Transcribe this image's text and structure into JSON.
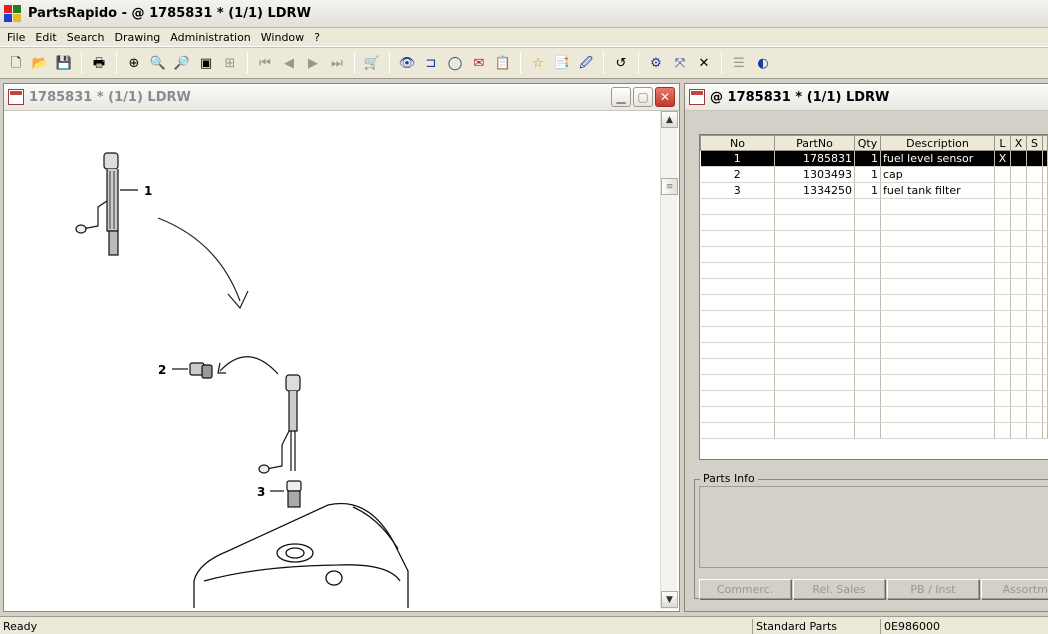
{
  "window": {
    "title": "PartsRapido - @ 1785831 * (1/1) LDRW"
  },
  "menu": [
    "File",
    "Edit",
    "Search",
    "Drawing",
    "Administration",
    "Window",
    "?"
  ],
  "toolbar": {
    "g1": [
      "🗋",
      "📂",
      "💾"
    ],
    "g2": [
      "🖶"
    ],
    "g3": [
      "⊕",
      "🔍",
      "🔎",
      "▣",
      "⊞"
    ],
    "g4": [
      "⏮",
      "◀",
      "▶",
      "⏭"
    ],
    "g5": [
      "🛒"
    ],
    "g6": [
      "👁",
      "⊐",
      "◯",
      "✉",
      "📋"
    ],
    "g7": [
      "☆",
      "📑",
      "🖉"
    ],
    "g8": [
      "↺"
    ],
    "g9": [
      "⚙",
      "⤧",
      "✕"
    ],
    "g10": [
      "☰",
      "◐"
    ]
  },
  "drawing_window": {
    "title": "1785831 * (1/1) LDRW",
    "callouts": [
      "1",
      "2",
      "3"
    ]
  },
  "parts_window": {
    "title": "@ 1785831 * (1/1) LDRW",
    "columns": [
      "No",
      "PartNo",
      "Qty",
      "Description",
      "L",
      "X",
      "S"
    ],
    "rows": [
      {
        "no": "1",
        "partno": "1785831",
        "qty": "1",
        "desc": "fuel level sensor",
        "l": "X",
        "x": "",
        "s": ""
      },
      {
        "no": "2",
        "partno": "1303493",
        "qty": "1",
        "desc": "cap",
        "l": "",
        "x": "",
        "s": ""
      },
      {
        "no": "3",
        "partno": "1334250",
        "qty": "1",
        "desc": "fuel tank filter",
        "l": "",
        "x": "",
        "s": ""
      }
    ],
    "parts_info_label": "Parts Info",
    "buttons": [
      "Commerc.",
      "Rel. Sales",
      "PB / Inst",
      "Assortm."
    ]
  },
  "status": {
    "left": "Ready",
    "mid": "Standard Parts",
    "right": "0E986000"
  }
}
